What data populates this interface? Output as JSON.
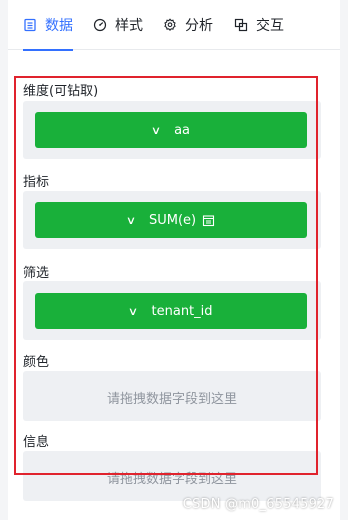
{
  "tabs": [
    {
      "label": "数据",
      "icon": "database-icon",
      "active": true
    },
    {
      "label": "样式",
      "icon": "gauge-icon",
      "active": false
    },
    {
      "label": "分析",
      "icon": "gear-icon",
      "active": false
    },
    {
      "label": "交互",
      "icon": "link-icon",
      "active": false
    }
  ],
  "sections": {
    "dimension": {
      "label": "维度(可钻取)",
      "field": "aa"
    },
    "metric": {
      "label": "指标",
      "field": "SUM(e)",
      "badge_icon": "calendar-icon"
    },
    "filter": {
      "label": "筛选",
      "field": "tenant_id"
    },
    "color": {
      "label": "颜色",
      "placeholder": "请拖拽数据字段到这里"
    },
    "info": {
      "label": "信息",
      "placeholder": "请拖拽数据字段到这里"
    }
  },
  "colors": {
    "accent": "#3370ff",
    "field_pill": "#19b03a",
    "highlight_border": "#e0232d",
    "well": "#eef0f3"
  },
  "chevron": "∨",
  "watermark": "CSDN @m0_65545927"
}
